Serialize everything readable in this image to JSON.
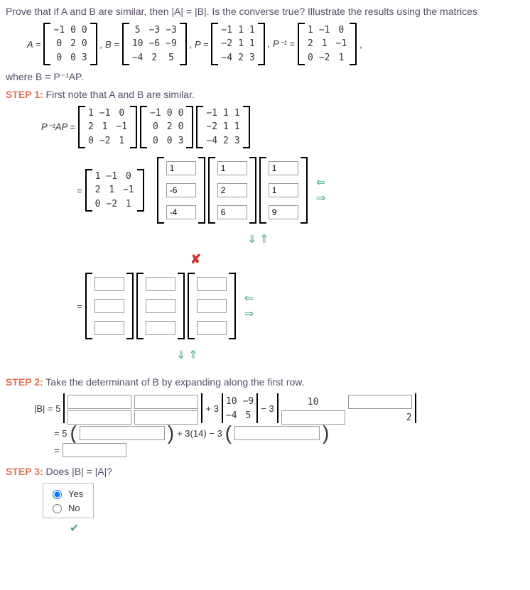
{
  "problem": {
    "statement": "Prove that if A and B are similar, then |A| = |B|. Is the converse true? Illustrate the results using the matrices",
    "A_label": "A = ",
    "B_label": ", B = ",
    "P_label": ", P = ",
    "Pinv_label": ", P⁻¹ = ",
    "comma": ",",
    "A": [
      "−1",
      "0",
      "0",
      "0",
      "2",
      "0",
      "0",
      "0",
      "3"
    ],
    "B": [
      "5",
      "−3",
      "−3",
      "10",
      "−6",
      "−9",
      "−4",
      "2",
      "5"
    ],
    "P": [
      "−1",
      "1",
      "1",
      "−2",
      "1",
      "1",
      "−4",
      "2",
      "3"
    ],
    "Pinv": [
      "1",
      "−1",
      "0",
      "2",
      "1",
      "−1",
      "0",
      "−2",
      "1"
    ],
    "where": "where B = P⁻¹AP."
  },
  "step1": {
    "label": "STEP 1:",
    "text": " First note that A and B are similar.",
    "lhs": "P⁻¹AP = ",
    "eq": "= ",
    "Pinv": [
      "1",
      "−1",
      "0",
      "2",
      "1",
      "−1",
      "0",
      "−2",
      "1"
    ],
    "A": [
      "−1",
      "0",
      "0",
      "0",
      "2",
      "0",
      "0",
      "0",
      "3"
    ],
    "P": [
      "−1",
      "1",
      "1",
      "−2",
      "1",
      "1",
      "−4",
      "2",
      "3"
    ],
    "col1": [
      "1",
      "-6",
      "-4"
    ],
    "col2": [
      "1",
      "2",
      "6"
    ],
    "col3": [
      "1",
      "1",
      "9"
    ]
  },
  "step2": {
    "label": "STEP 2:",
    "text": " Take the determinant of B by expanding along the first row.",
    "lhs": "|B| = 5",
    "plus3": "+ 3",
    "minus3": " − 3",
    "m1": [
      "10",
      "−9",
      "−4",
      "5"
    ],
    "ten": "10",
    "two": "2",
    "line2a": "= 5",
    "line2b": " + 3(14) − 3",
    "line3": "= "
  },
  "step3": {
    "label": "STEP 3:",
    "text": " Does |B| = |A|?",
    "yes": "Yes",
    "no": "No"
  }
}
